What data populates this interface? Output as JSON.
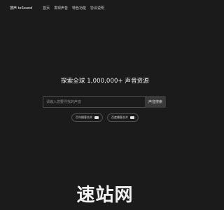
{
  "header": {
    "brand": "搜声 toSound",
    "nav": [
      "首页",
      "发现声音",
      "特色功能",
      "协议说明"
    ]
  },
  "hero": {
    "title": "探索全球 1,000,000+ 声音资源"
  },
  "search": {
    "placeholder": "请输入您要寻找的声音",
    "button_label": "声音搜索"
  },
  "chips": [
    {
      "label": "百年播客合并",
      "badge_icon": "keyboard-icon"
    },
    {
      "label": "百度播客合并",
      "badge_icon": "keyboard-icon"
    }
  ],
  "watermark": {
    "text": "速站网"
  }
}
